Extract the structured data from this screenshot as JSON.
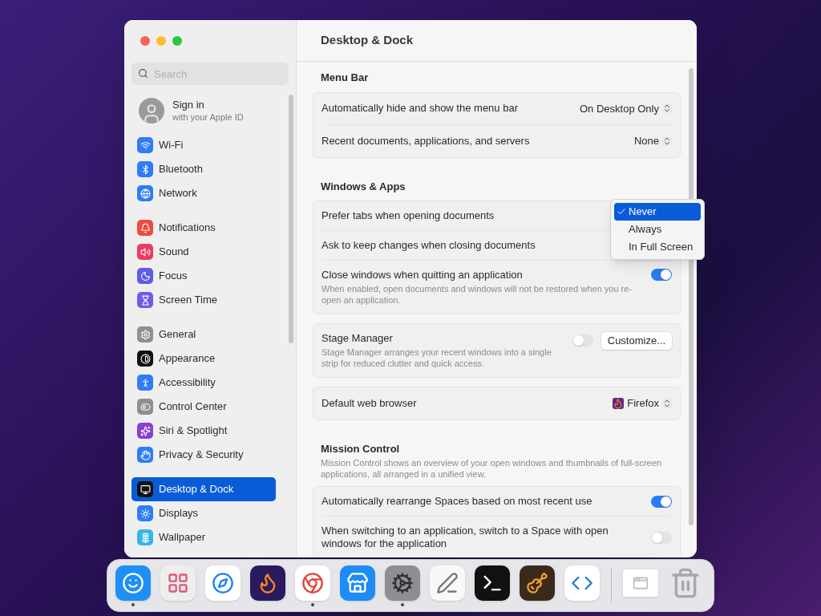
{
  "window": {
    "title": "Desktop & Dock"
  },
  "sidebar": {
    "search_placeholder": "Search",
    "account": {
      "title": "Sign in",
      "subtitle": "with your Apple ID"
    },
    "groups": [
      [
        {
          "label": "Wi-Fi",
          "selected": false
        },
        {
          "label": "Bluetooth",
          "selected": false
        },
        {
          "label": "Network",
          "selected": false
        }
      ],
      [
        {
          "label": "Notifications",
          "selected": false
        },
        {
          "label": "Sound",
          "selected": false
        },
        {
          "label": "Focus",
          "selected": false
        },
        {
          "label": "Screen Time",
          "selected": false
        }
      ],
      [
        {
          "label": "General",
          "selected": false
        },
        {
          "label": "Appearance",
          "selected": false
        },
        {
          "label": "Accessibility",
          "selected": false
        },
        {
          "label": "Control Center",
          "selected": false
        },
        {
          "label": "Siri & Spotlight",
          "selected": false
        },
        {
          "label": "Privacy & Security",
          "selected": false
        }
      ],
      [
        {
          "label": "Desktop & Dock",
          "selected": true
        },
        {
          "label": "Displays",
          "selected": false
        },
        {
          "label": "Wallpaper",
          "selected": false
        }
      ]
    ]
  },
  "sections": [
    {
      "heading": "Menu Bar",
      "groups": [
        [
          {
            "kind": "popup",
            "label": "Automatically hide and show the menu bar",
            "value": "On Desktop Only"
          },
          {
            "kind": "popup",
            "label": "Recent documents, applications, and servers",
            "value": "None"
          }
        ]
      ]
    },
    {
      "heading": "Windows & Apps",
      "groups": [
        [
          {
            "kind": "plain",
            "label": "Prefer tabs when opening documents"
          },
          {
            "kind": "plain",
            "label": "Ask to keep changes when closing documents"
          },
          {
            "kind": "toggle",
            "label": "Close windows when quitting an application",
            "description": "When enabled, open documents and windows will not be restored when you re-open an application.",
            "on": true
          }
        ],
        [
          {
            "kind": "toggle_button",
            "label": "Stage Manager",
            "description": "Stage Manager arranges your recent windows into a single strip for reduced clutter and quick access.",
            "on": false,
            "button": "Customize..."
          }
        ],
        [
          {
            "kind": "browser",
            "label": "Default web browser",
            "value": "Firefox"
          }
        ]
      ]
    },
    {
      "heading": "Mission Control",
      "description": "Mission Control shows an overview of your open windows and thumbnails of full-screen applications, all arranged in a unified view.",
      "groups": [
        [
          {
            "kind": "toggle",
            "label": "Automatically rearrange Spaces based on most recent use",
            "on": true
          },
          {
            "kind": "toggle",
            "label": "When switching to an application, switch to a Space with open windows for the application",
            "on": false
          }
        ]
      ]
    }
  ],
  "popup_menu": {
    "items": [
      {
        "label": "Never",
        "selected": true
      },
      {
        "label": "Always",
        "selected": false
      },
      {
        "label": "In Full Screen",
        "selected": false
      }
    ]
  },
  "dock": [
    {
      "running": true
    },
    {
      "running": false
    },
    {
      "running": false
    },
    {
      "running": false
    },
    {
      "running": true
    },
    {
      "running": false
    },
    {
      "running": true
    },
    {
      "running": false
    },
    {
      "running": false
    },
    {
      "running": false
    },
    {
      "running": false
    }
  ]
}
